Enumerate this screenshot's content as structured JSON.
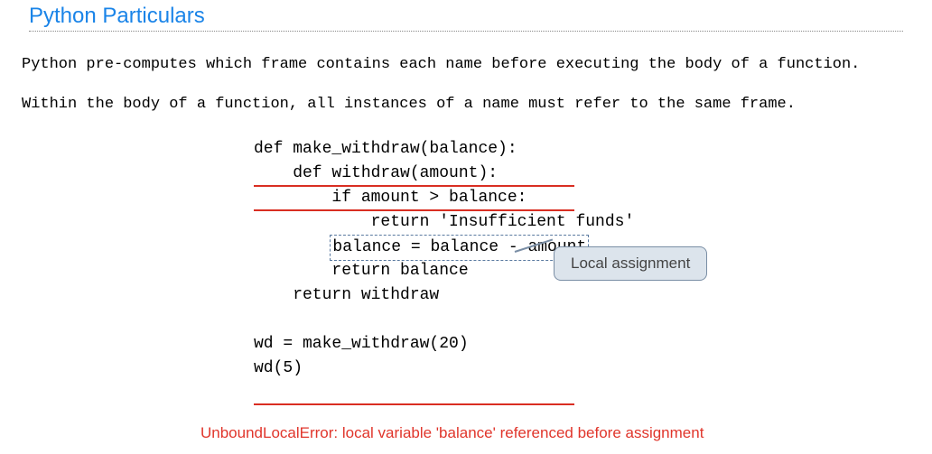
{
  "title": "Python Particulars",
  "body": {
    "line1": "Python pre-computes which frame contains each name before executing the body of a function.",
    "line2": "Within the body of a function, all instances of a name must refer to the same frame."
  },
  "code": {
    "l1": "def make_withdraw(balance):",
    "l2": "    def withdraw(amount):",
    "l3": "        if amount > balance:",
    "l4": "            return 'Insufficient funds'",
    "l5_indent": "        ",
    "l5_box": "balance = balance - amount",
    "l6": "        return balance",
    "l7": "    return withdraw",
    "l8": "",
    "l9": "wd = make_withdraw(20)",
    "l10": "wd(5)"
  },
  "callout": {
    "label": "Local assignment"
  },
  "error": {
    "text": "UnboundLocalError: local variable 'balance' referenced before assignment"
  }
}
